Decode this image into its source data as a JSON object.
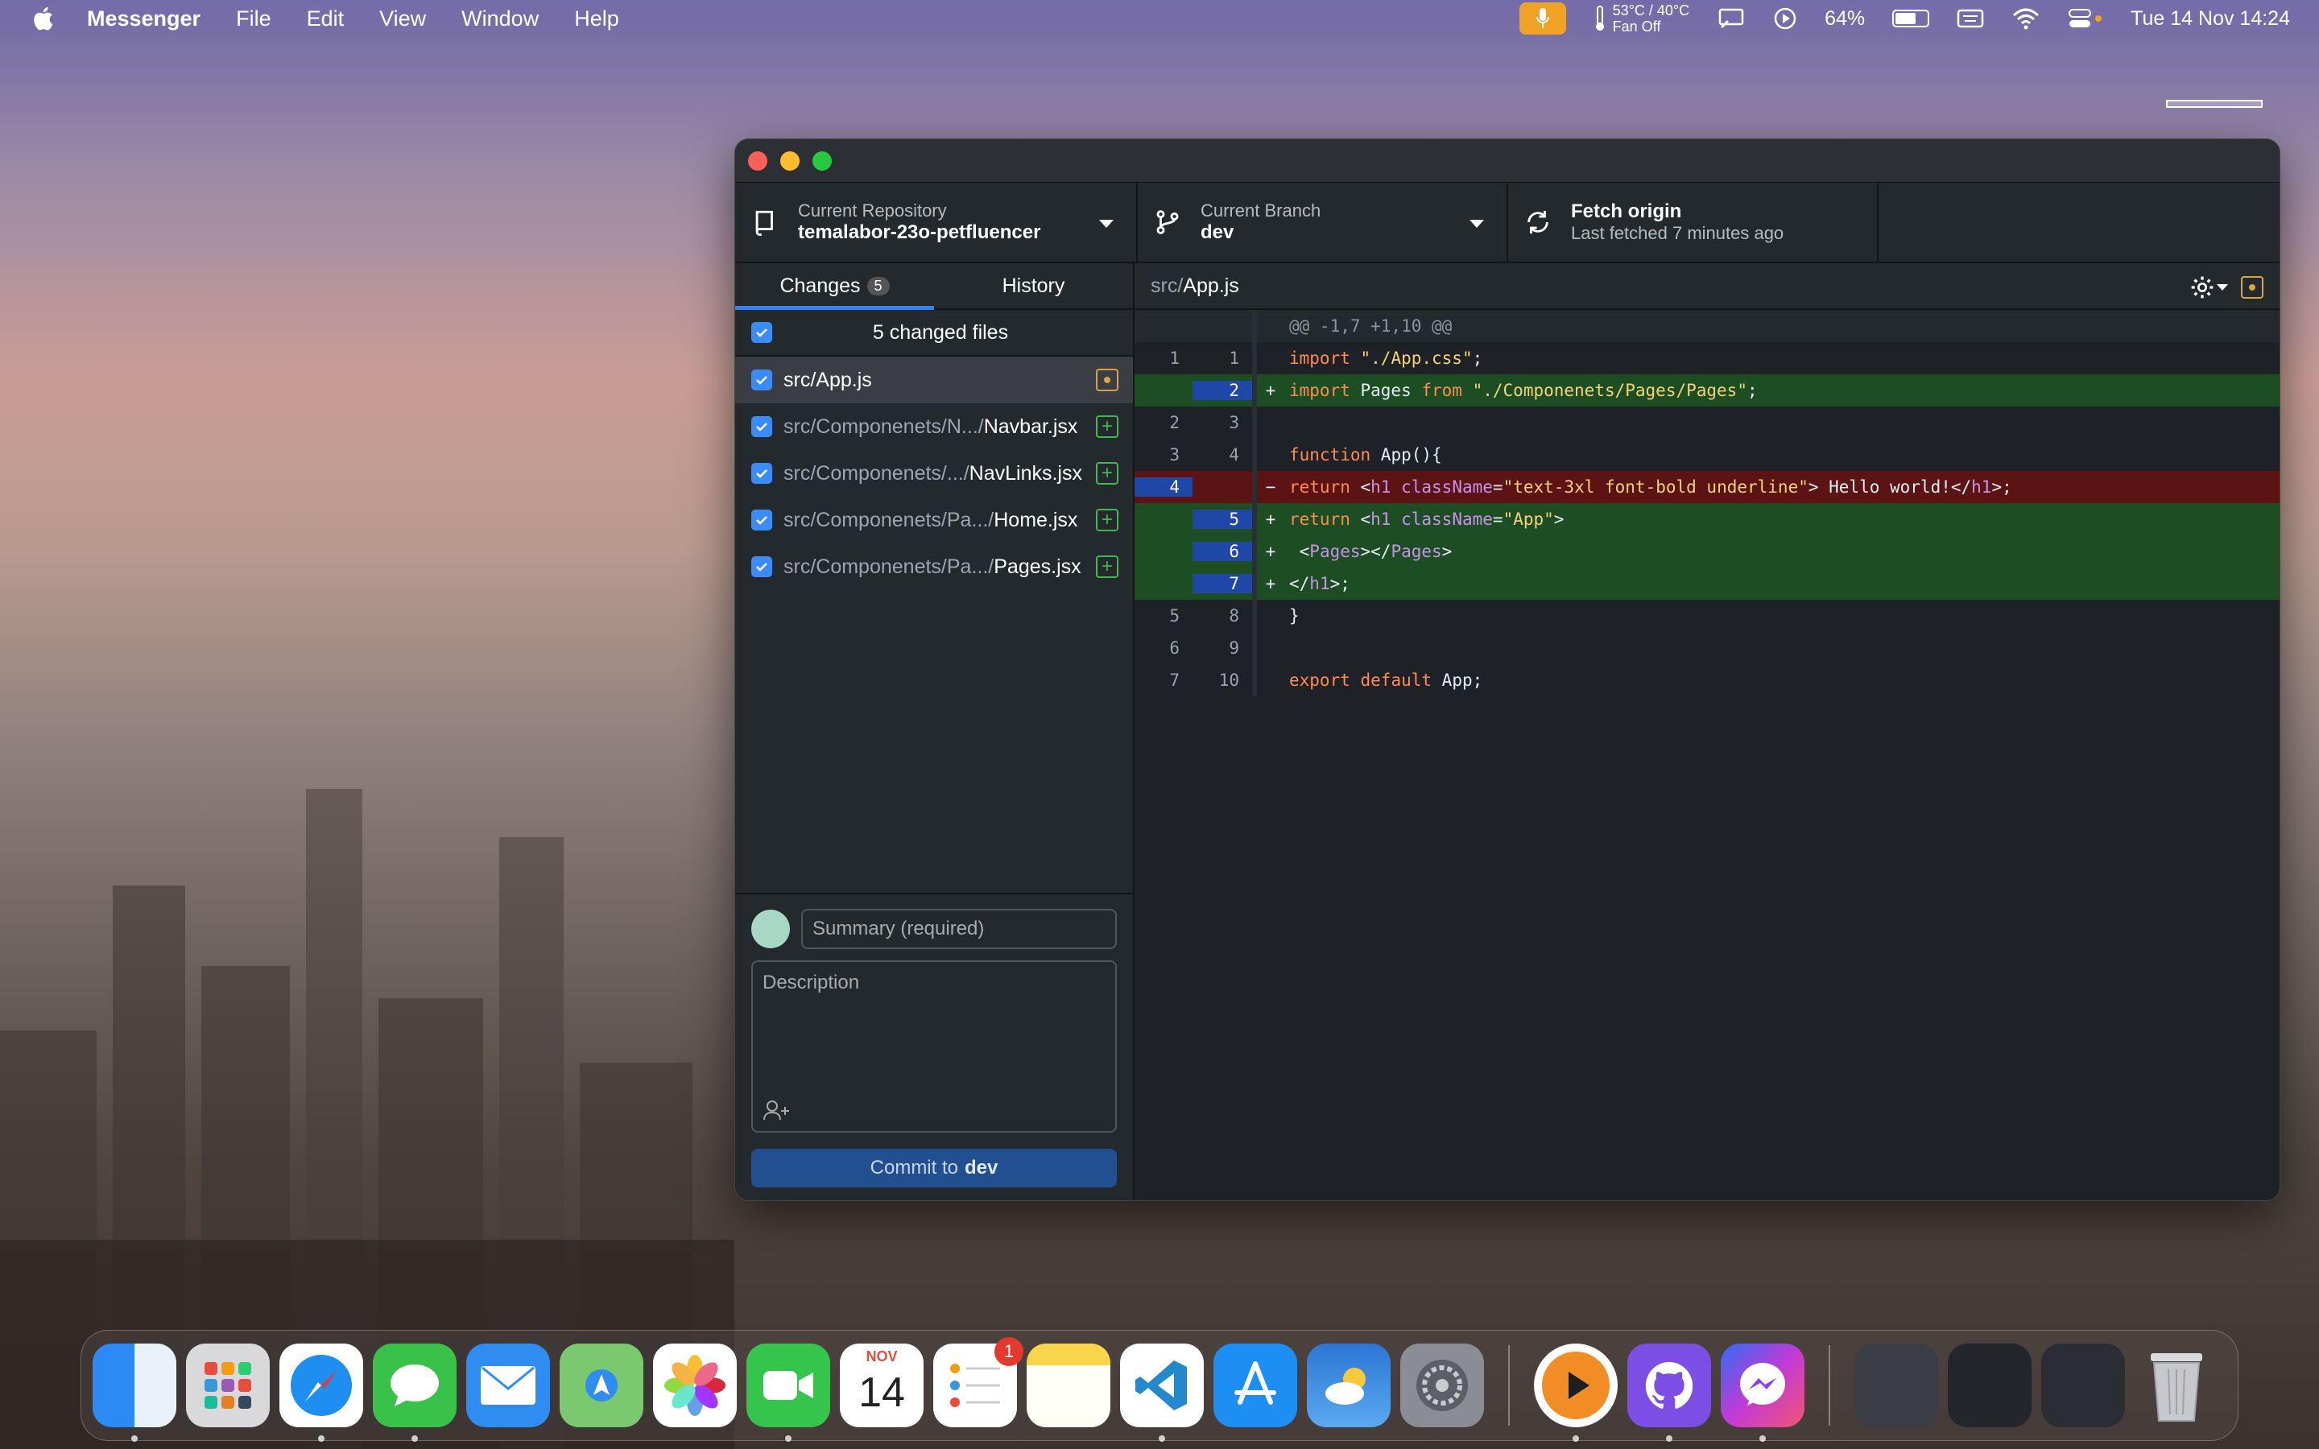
{
  "menubar": {
    "app_name": "Messenger",
    "menus": [
      "File",
      "Edit",
      "View",
      "Window",
      "Help"
    ],
    "temperature": "53°C / 40°C",
    "fan": "Fan Off",
    "battery": "64%",
    "datetime": "Tue 14 Nov  14:24"
  },
  "toolbar": {
    "repo_label": "Current Repository",
    "repo_name": "temalabor-23o-petfluencer",
    "branch_label": "Current Branch",
    "branch_name": "dev",
    "fetch_title": "Fetch origin",
    "fetch_sub": "Last fetched 7 minutes ago"
  },
  "tabs": {
    "changes_label": "Changes",
    "changes_count": "5",
    "history_label": "History"
  },
  "changes": {
    "header": "5 changed files",
    "files": [
      {
        "dir": "",
        "name": "src/App.js",
        "status": "modified"
      },
      {
        "dir": "src/Componenets/N.../",
        "name": "Navbar.jsx",
        "status": "added"
      },
      {
        "dir": "src/Componenets/.../",
        "name": "NavLinks.jsx",
        "status": "added"
      },
      {
        "dir": "src/Componenets/Pa.../",
        "name": "Home.jsx",
        "status": "added"
      },
      {
        "dir": "src/Componenets/Pa.../",
        "name": "Pages.jsx",
        "status": "added"
      }
    ]
  },
  "commit": {
    "summary_placeholder": "Summary (required)",
    "description_placeholder": "Description",
    "button_prefix": "Commit to",
    "button_branch": "dev"
  },
  "diff": {
    "path_dir": "src/",
    "path_file": "App.js",
    "hunk": "@@ -1,7 +1,10 @@",
    "lines": [
      {
        "type": "ctx",
        "old": "1",
        "new": "1",
        "sign": "",
        "code": "import \"./App.css\";"
      },
      {
        "type": "add",
        "old": "",
        "new": "2",
        "sign": "+",
        "code": "import Pages from \"./Componenets/Pages/Pages\";"
      },
      {
        "type": "ctx",
        "old": "2",
        "new": "3",
        "sign": "",
        "code": ""
      },
      {
        "type": "ctx",
        "old": "3",
        "new": "4",
        "sign": "",
        "code": "function App(){"
      },
      {
        "type": "del",
        "old": "4",
        "new": "",
        "sign": "−",
        "code": "return <h1 className=\"text-3xl font-bold underline\"> Hello world!</h1>;"
      },
      {
        "type": "add",
        "old": "",
        "new": "5",
        "sign": "+",
        "code": "return <h1 className=\"App\">"
      },
      {
        "type": "add",
        "old": "",
        "new": "6",
        "sign": "+",
        "code": " <Pages></Pages>"
      },
      {
        "type": "add",
        "old": "",
        "new": "7",
        "sign": "+",
        "code": "</h1>;"
      },
      {
        "type": "ctx",
        "old": "5",
        "new": "8",
        "sign": "",
        "code": "}"
      },
      {
        "type": "ctx",
        "old": "6",
        "new": "9",
        "sign": "",
        "code": ""
      },
      {
        "type": "ctx",
        "old": "7",
        "new": "10",
        "sign": "",
        "code": "export default App;"
      }
    ]
  },
  "dock": {
    "calendar_month": "NOV",
    "calendar_day": "14",
    "reminders_badge": "1",
    "apps": [
      "finder-icon",
      "launchpad-icon",
      "safari-icon",
      "messages-icon",
      "mail-icon",
      "maps-icon",
      "photos-icon",
      "facetime-icon",
      "calendar-icon",
      "reminders-icon",
      "notes-icon",
      "vscode-icon",
      "app-store-icon",
      "weather-icon",
      "system-settings-icon",
      "infuse-icon",
      "github-desktop-icon",
      "messenger-icon"
    ]
  },
  "colors": {
    "accent": "#2f81f7",
    "added_bg": "#1d4d23",
    "removed_bg": "#5c1313",
    "line_number_highlight": "#1f47a8",
    "modified": "#d8a73a",
    "added": "#3fb950"
  }
}
